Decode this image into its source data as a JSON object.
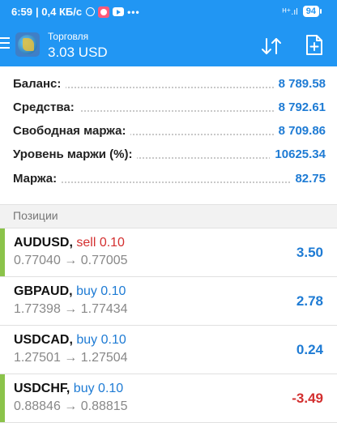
{
  "status_bar": {
    "time": "6:59",
    "network_speed": "| 0,4 КБ/с",
    "signal": "ᴴ⁺.ıl",
    "battery": "94"
  },
  "header": {
    "section": "Торговля",
    "profit_total": "3.03 USD",
    "icons": [
      "menu-icon",
      "app-logo",
      "sort-icon",
      "new-order-icon"
    ]
  },
  "summary": [
    {
      "label": "Баланс:",
      "value": "8 789.58"
    },
    {
      "label": "Средства:",
      "value": "8 792.61"
    },
    {
      "label": "Свободная маржа:",
      "value": "8 709.86"
    },
    {
      "label": "Уровень маржи (%):",
      "value": "10625.34"
    },
    {
      "label": "Маржа:",
      "value": "82.75"
    }
  ],
  "positions_header": "Позиции",
  "positions": [
    {
      "symbol": "AUDUSD",
      "separator": ",",
      "side": "sell 0.10",
      "prices": "0.77040 → 0.77005",
      "profit": "3.50"
    },
    {
      "symbol": "GBPAUD",
      "separator": ",",
      "side": "buy 0.10",
      "prices": "1.77398 → 1.77434",
      "profit": "2.78"
    },
    {
      "symbol": "USDCAD",
      "separator": ",",
      "side": "buy 0.10",
      "prices": "1.27501 → 1.27504",
      "profit": "0.24"
    },
    {
      "symbol": "USDCHF",
      "separator": ",",
      "side": "buy 0.10",
      "prices": "0.88846 → 0.88815",
      "profit": "-3.49"
    }
  ],
  "colors": {
    "topbar": "#2196f3",
    "value_blue": "#1e7bd4",
    "loss_red": "#d32f2f",
    "accent_bar": "#8bc34a"
  }
}
